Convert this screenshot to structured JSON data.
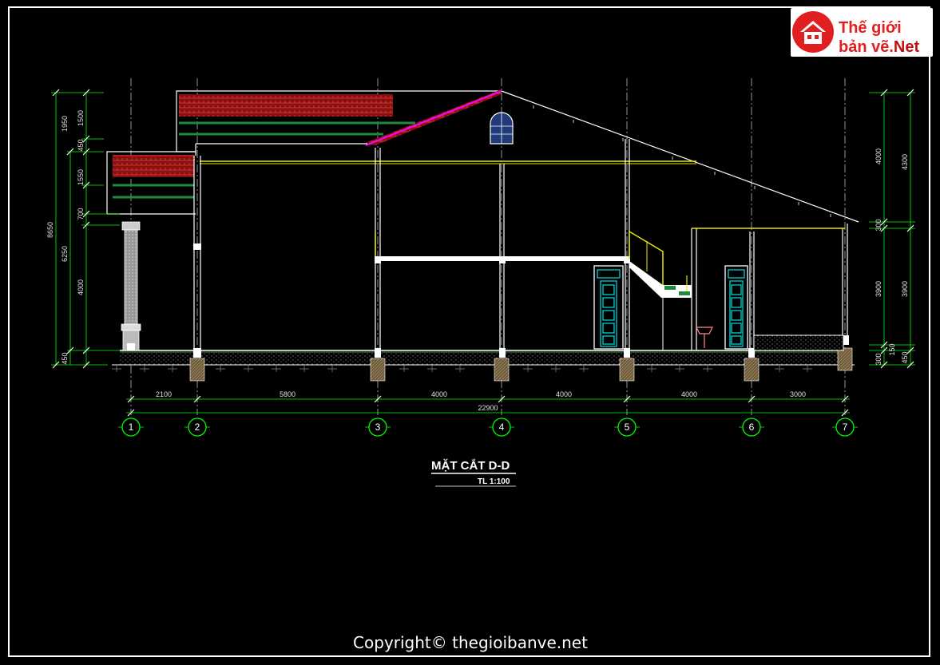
{
  "logo": {
    "line1": "Thế giới",
    "line2": "bản vẽ.",
    "net": "Net",
    "brand_red": "#e02020"
  },
  "drawing": {
    "title": "MẶT CẮT D-D",
    "scale": "TL 1:100",
    "copyright": "Copyright© thegioibanve.net"
  },
  "axes": [
    "1",
    "2",
    "3",
    "4",
    "5",
    "6",
    "7"
  ],
  "bay_dims": [
    "2100",
    "5800",
    "4000",
    "4000",
    "4000",
    "3000"
  ],
  "total_dim": "22900",
  "left_dims": {
    "total": "8650",
    "part_a": "6250",
    "part_b": "4000",
    "d1950": "1950",
    "d1500": "1500",
    "d450a": "450",
    "d1550": "1550",
    "d700": "700",
    "d450b": "450"
  },
  "right_dims": {
    "d4000": "4000",
    "d4300": "4300",
    "d300a": "300",
    "d3900a": "3900",
    "d3900b": "3900",
    "d300b": "300",
    "d150": "150",
    "d450": "450"
  },
  "colors": {
    "background": "#000000",
    "axis_green": "#00ff00",
    "wall_white": "#ffffff",
    "roof_red": "#b01818",
    "rafter_green": "#1e8c3a",
    "beam_yellow": "#e8e800",
    "door_cyan": "#00d0d0",
    "stair_magenta": "#ff00ff"
  }
}
